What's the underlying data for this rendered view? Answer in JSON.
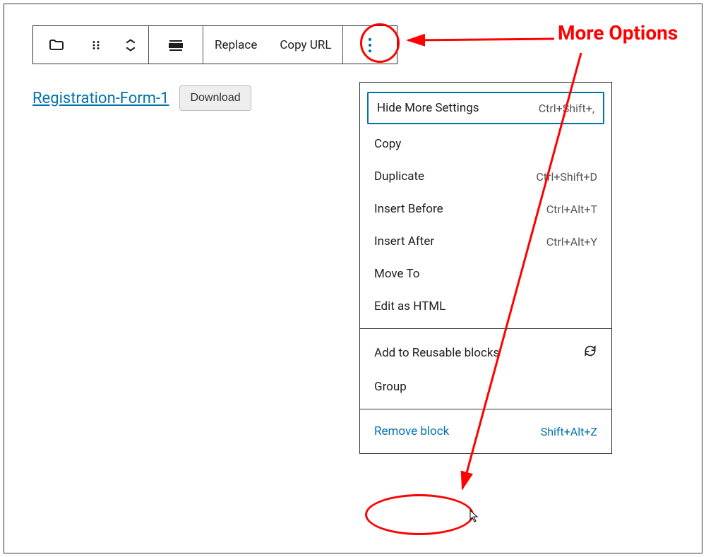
{
  "toolbar": {
    "replace_label": "Replace",
    "copy_url_label": "Copy URL"
  },
  "file": {
    "link_text": "Registration-Form-1",
    "download_label": "Download"
  },
  "menu": {
    "hide_more_settings": {
      "label": "Hide More Settings",
      "shortcut": "Ctrl+Shift+,"
    },
    "copy": {
      "label": "Copy"
    },
    "duplicate": {
      "label": "Duplicate",
      "shortcut": "Ctrl+Shift+D"
    },
    "insert_before": {
      "label": "Insert Before",
      "shortcut": "Ctrl+Alt+T"
    },
    "insert_after": {
      "label": "Insert After",
      "shortcut": "Ctrl+Alt+Y"
    },
    "move_to": {
      "label": "Move To"
    },
    "edit_html": {
      "label": "Edit as HTML"
    },
    "add_reusable": {
      "label": "Add to Reusable blocks"
    },
    "group": {
      "label": "Group"
    },
    "remove": {
      "label": "Remove block",
      "shortcut": "Shift+Alt+Z"
    }
  },
  "annotation": {
    "more_options_label": "More Options"
  }
}
